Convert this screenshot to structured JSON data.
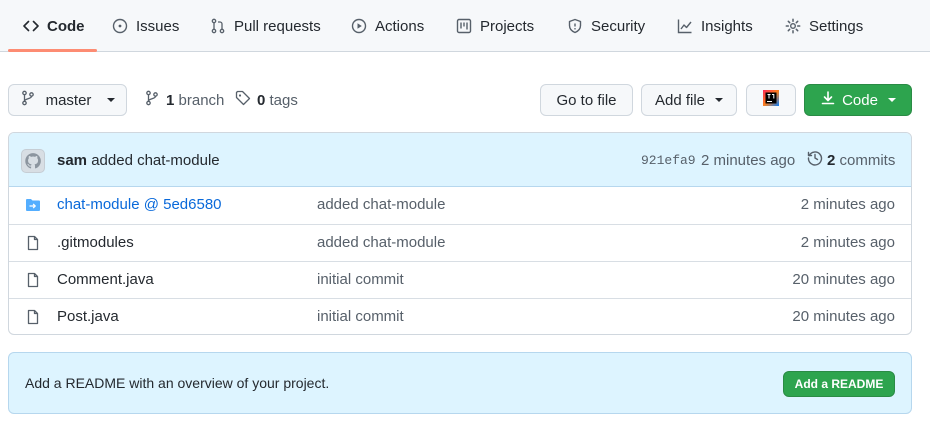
{
  "tabs": [
    {
      "label": "Code",
      "icon": "code-icon",
      "active": true
    },
    {
      "label": "Issues",
      "icon": "issue-icon"
    },
    {
      "label": "Pull requests",
      "icon": "pull-request-icon"
    },
    {
      "label": "Actions",
      "icon": "play-icon"
    },
    {
      "label": "Projects",
      "icon": "project-icon"
    },
    {
      "label": "Security",
      "icon": "shield-icon"
    },
    {
      "label": "Insights",
      "icon": "graph-icon"
    },
    {
      "label": "Settings",
      "icon": "gear-icon"
    }
  ],
  "toolbar": {
    "branch_select": "master",
    "branch_count": "1",
    "branch_label": "branch",
    "tag_count": "0",
    "tag_label": "tags",
    "go_to_file": "Go to file",
    "add_file": "Add file",
    "code_button": "Code"
  },
  "latest_commit": {
    "author": "sam",
    "message": "added chat-module",
    "sha": "921efa9",
    "time": "2 minutes ago",
    "commit_count": "2",
    "commit_label": "commits"
  },
  "files": [
    {
      "name": "chat-module @ 5ed6580",
      "type": "submodule",
      "message": "added chat-module",
      "age": "2 minutes ago"
    },
    {
      "name": ".gitmodules",
      "type": "file",
      "message": "added chat-module",
      "age": "2 minutes ago"
    },
    {
      "name": "Comment.java",
      "type": "file",
      "message": "initial commit",
      "age": "20 minutes ago"
    },
    {
      "name": "Post.java",
      "type": "file",
      "message": "initial commit",
      "age": "20 minutes ago"
    }
  ],
  "readme": {
    "text": "Add a README with an overview of your project.",
    "button": "Add a README"
  },
  "colors": {
    "accent_green": "#2da44e",
    "link_blue": "#0969da",
    "tab_underline": "#fd8c73",
    "banner_bg": "#ddf4ff"
  }
}
